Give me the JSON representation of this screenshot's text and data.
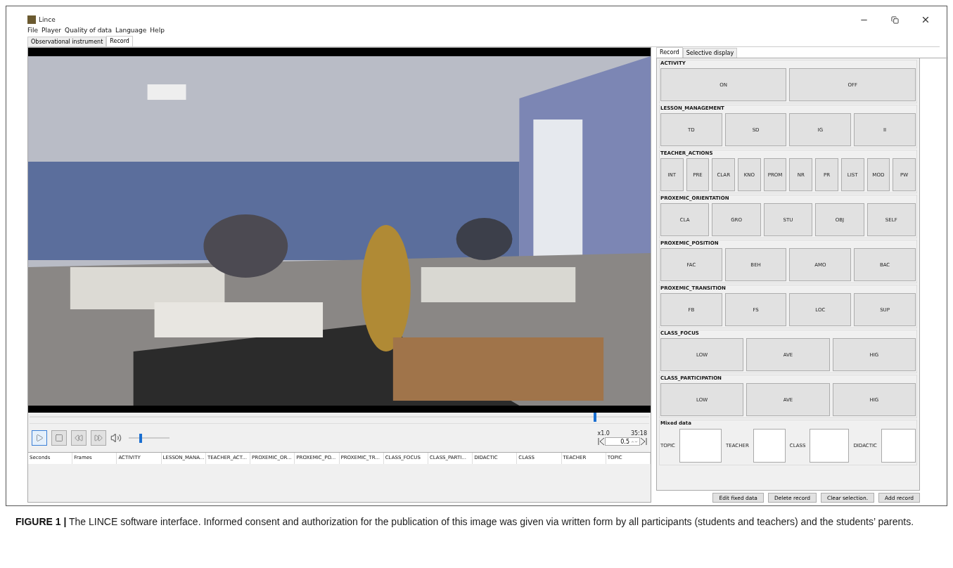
{
  "window": {
    "title": "Lince"
  },
  "menu": [
    "File",
    "Player",
    "Quality of data",
    "Language",
    "Help"
  ],
  "tabs": [
    {
      "label": "Observational instrument",
      "selected": false
    },
    {
      "label": "Record",
      "selected": true
    }
  ],
  "video": {
    "kind": "picture"
  },
  "seek": {
    "level": 0.91
  },
  "controls": [
    {
      "kind": "play",
      "selected": true
    },
    {
      "kind": "stop",
      "selected": false
    },
    {
      "kind": "rewind",
      "selected": false
    },
    {
      "kind": "forward",
      "selected": false
    }
  ],
  "volume": {
    "level": 0.25
  },
  "speed": "x1.0",
  "time": "35:18",
  "step": "0.5",
  "table": {
    "columns": [
      "Seconds",
      "Frames",
      "ACTIVITY",
      "LESSON_MANA...",
      "TEACHER_ACT...",
      "PROXEMIC_OR...",
      "PROXEMIC_PO...",
      "PROXEMIC_TR...",
      "CLASS_FOCUS",
      "CLASS_PARTI...",
      "DIDACTIC",
      "CLASS",
      "TEACHER",
      "TOPIC"
    ]
  },
  "side_tabs": [
    {
      "label": "Record",
      "selected": true
    },
    {
      "label": "Selective display",
      "selected": false
    }
  ],
  "criteria": [
    {
      "name": "ACTIVITY",
      "buttons": [
        "ON",
        "OFF"
      ]
    },
    {
      "name": "LESSON_MANAGEMENT",
      "buttons": [
        "TD",
        "SD",
        "IG",
        "II"
      ]
    },
    {
      "name": "TEACHER_ACTIONS",
      "buttons": [
        "INT",
        "PRE",
        "CLAR",
        "KNO",
        "PROM",
        "NR",
        "PR",
        "LIST",
        "MOD",
        "PW"
      ]
    },
    {
      "name": "PROXEMIC_ORIENTATION",
      "buttons": [
        "CLA",
        "GRO",
        "STU",
        "OBJ",
        "SELF"
      ]
    },
    {
      "name": "PROXEMIC_POSITION",
      "buttons": [
        "FAC",
        "BEH",
        "AMO",
        "BAC"
      ]
    },
    {
      "name": "PROXEMIC_TRANSITION",
      "buttons": [
        "FB",
        "FS",
        "LOC",
        "SUP"
      ]
    },
    {
      "name": "CLASS_FOCUS",
      "buttons": [
        "LOW",
        "AVE",
        "HIG"
      ]
    },
    {
      "name": "CLASS_PARTICIPATION",
      "buttons": [
        "LOW",
        "AVE",
        "HIG"
      ]
    }
  ],
  "mixed_data": {
    "title": "Mixed data",
    "fields": [
      "TOPIC",
      "TEACHER",
      "CLASS",
      "DIDACTIC"
    ]
  },
  "actions": [
    "Edit fixed data",
    "Delete record",
    "Clear selection.",
    "Add record"
  ],
  "caption": {
    "label": "FIGURE 1 |",
    "text": "The LINCE software interface. Informed consent and authorization for the publication of this image was given via written form by all participants (students and teachers) and the students’ parents."
  }
}
